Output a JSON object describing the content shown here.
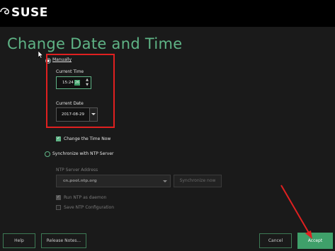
{
  "brand": {
    "logo_text": "SUSE"
  },
  "page": {
    "title": "Change Date and Time"
  },
  "manual": {
    "radio_label": "Manually",
    "current_time_label": "Current Time",
    "current_time_value": "15:24",
    "current_time_seconds": "26",
    "current_date_label": "Current Date",
    "current_date_value": "2017-08-29",
    "change_now_label": "Change the Time Now"
  },
  "ntp": {
    "radio_label": "Synchronize with NTP Server",
    "server_address_label": "NTP Server Address",
    "server_value": "cn.pool.ntp.org",
    "sync_now_label": "Synchronize now",
    "run_daemon_label": "Run NTP as daemon",
    "save_config_label": "Save NTP Configuration"
  },
  "footer": {
    "help_label": "Help",
    "release_notes_label": "Release Notes...",
    "cancel_label": "Cancel",
    "accept_label": "Accept"
  },
  "colors": {
    "accent": "#5fb486",
    "annotation": "#e02020",
    "background": "#1a1a1a"
  }
}
